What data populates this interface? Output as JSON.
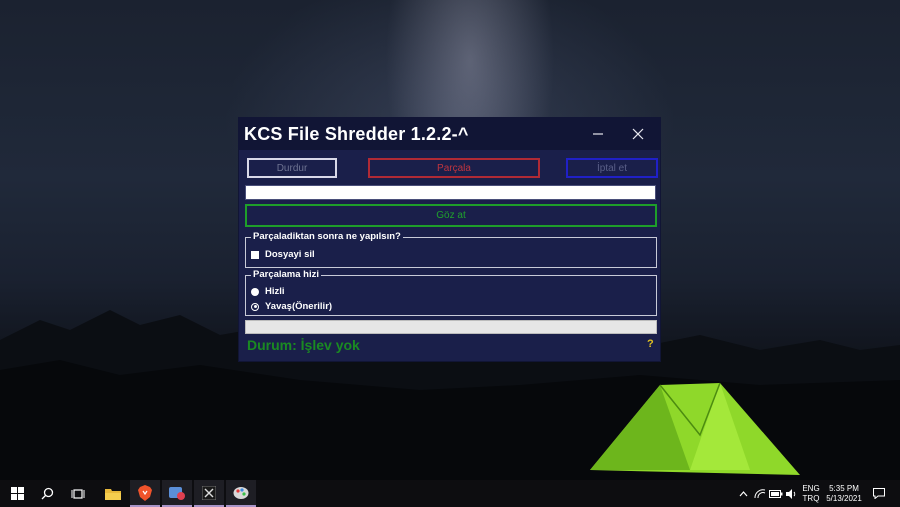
{
  "window": {
    "title": "KCS File Shredder 1.2.2-^",
    "minimize_icon": "minimize-icon",
    "close_icon": "close-icon"
  },
  "toolbar": {
    "stop_label": "Durdur",
    "shred_label": "Parçala",
    "cancel_label": "İptal et"
  },
  "path": {
    "value": "",
    "placeholder": ""
  },
  "browse": {
    "label": "Göz at"
  },
  "after_shred": {
    "legend": "Parçaladiktan sonra ne yapılsın?",
    "delete_file_label": "Dosyayi sil",
    "delete_file_checked": false
  },
  "speed": {
    "legend": "Parçalama hizi",
    "options": [
      "Hizli",
      "Yavaş(Önerilir)"
    ],
    "selected": "Yavaş(Önerilir)"
  },
  "progress": {
    "value": 0
  },
  "status": {
    "text": "Durum: İşlev yok"
  },
  "help": {
    "label": "?"
  },
  "colors": {
    "window_bg": "#1a1f4a",
    "titlebar_bg": "#111535",
    "shred_accent": "#b02a35",
    "cancel_accent": "#2020c8",
    "browse_accent": "#1e9e2a",
    "status_color": "#1a8a22",
    "help_color": "#e0c020"
  },
  "taskbar": {
    "items": [
      "start-icon",
      "search-icon",
      "task-view-icon",
      "file-explorer-icon",
      "brave-browser-icon",
      "app-icon",
      "kcs-shredder-icon",
      "paint-icon"
    ],
    "language_top": "ENG",
    "language_bottom": "TRQ",
    "time": "5:35 PM",
    "date": "5/13/2021"
  }
}
